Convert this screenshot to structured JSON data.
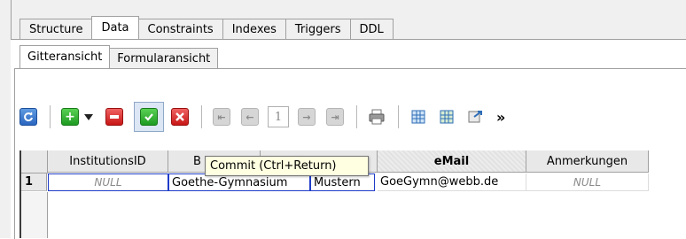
{
  "main_tabs": [
    "Structure",
    "Data",
    "Constraints",
    "Indexes",
    "Triggers",
    "DDL"
  ],
  "main_tab_active": "Data",
  "sub_tabs": [
    "Gitteransicht",
    "Formularansicht"
  ],
  "sub_tab_active": "Gitteransicht",
  "toolbar": {
    "refresh_icon": "refresh-icon",
    "add_icon": "plus-icon",
    "delete_icon": "minus-icon",
    "commit_icon": "check-icon",
    "rollback_icon": "x-icon",
    "first_icon": "first-page-icon",
    "prev_icon": "prev-page-icon",
    "page_number": "1",
    "next_icon": "next-page-icon",
    "last_icon": "last-page-icon",
    "print_icon": "printer-icon",
    "more": "»"
  },
  "tooltip": "Commit (Ctrl+Return)",
  "grid": {
    "columns": [
      "InstitutionsID",
      "B",
      "",
      "eMail",
      "Anmerkungen"
    ],
    "rows": [
      {
        "num": "1",
        "cells": [
          "NULL",
          "Goethe-Gymnasium",
          "Mustern",
          "GoeGymn@webb.de",
          "NULL"
        ]
      }
    ]
  },
  "colors": {
    "selection_border": "#1f3cc8",
    "tooltip_bg": "#ffffe1"
  }
}
